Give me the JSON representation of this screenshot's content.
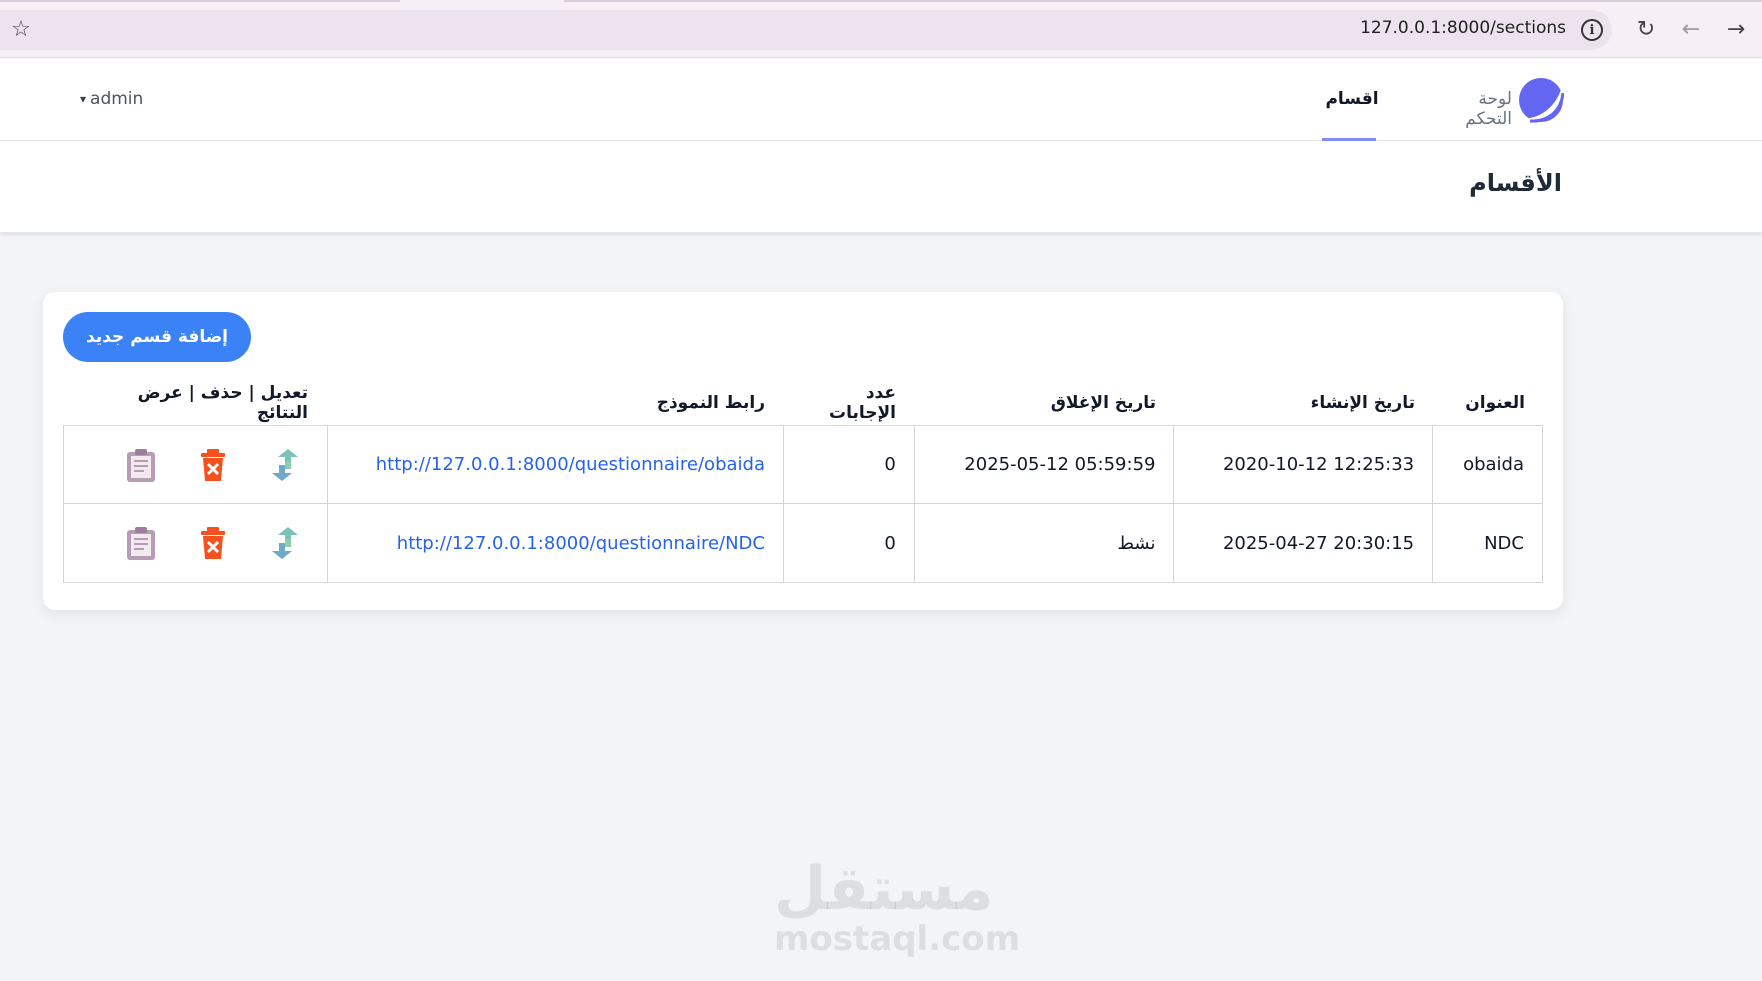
{
  "browser": {
    "url": "127.0.0.1:8000/sections"
  },
  "nav": {
    "dashboard": "لوحة التحكم",
    "sections": "اقسام",
    "user": "admin"
  },
  "page": {
    "title": "الأقسام"
  },
  "card": {
    "add_button": "إضافة قسم جديد"
  },
  "table": {
    "headers": {
      "title": "العنوان",
      "created": "تاريخ الإنشاء",
      "closed": "تاريخ الإغلاق",
      "count": "عدد الإجابات",
      "link": "رابط النموذج",
      "actions": "تعديل | حذف | عرض النتائج"
    },
    "rows": [
      {
        "title": "obaida",
        "created": "2020-10-12 12:25:33",
        "closed": "2025-05-12 05:59:59",
        "count": "0",
        "link": "http://127.0.0.1:8000/questionnaire/obaida"
      },
      {
        "title": "NDC",
        "created": "2025-04-27 20:30:15",
        "closed": "نشط",
        "count": "0",
        "link": "http://127.0.0.1:8000/questionnaire/NDC"
      }
    ]
  },
  "watermark": {
    "arabic": "مستقل",
    "latin": "mostaql.com"
  },
  "colors": {
    "primary": "#3b82f6",
    "link": "#2563eb",
    "nav_active": "#818cf8",
    "delete_icon": "#f4511e",
    "edit_icon": "#7cc3b5",
    "results_icon": "#b79cb5"
  }
}
